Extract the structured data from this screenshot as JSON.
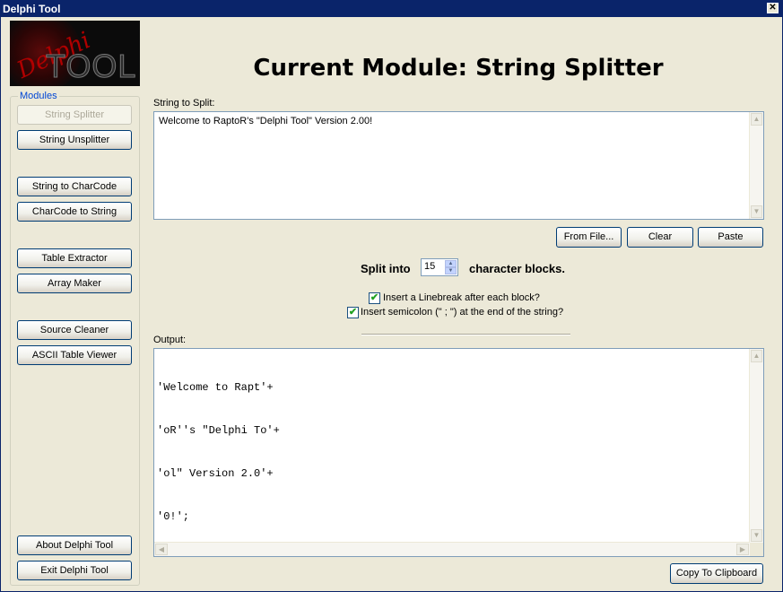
{
  "window": {
    "title": "Delphi Tool",
    "close_glyph": "✕"
  },
  "logo": {
    "script_text": "Delphi",
    "block_text": "TOOL"
  },
  "modules": {
    "legend": "Modules",
    "items": [
      {
        "label": "String Splitter",
        "enabled": false
      },
      {
        "label": "String Unsplitter",
        "enabled": true
      },
      {
        "label": "String to CharCode",
        "enabled": true
      },
      {
        "label": "CharCode to String",
        "enabled": true
      },
      {
        "label": "Table Extractor",
        "enabled": true
      },
      {
        "label": "Array Maker",
        "enabled": true
      },
      {
        "label": "Source Cleaner",
        "enabled": true
      },
      {
        "label": "ASCII Table Viewer",
        "enabled": true
      }
    ],
    "about_label": "About Delphi Tool",
    "exit_label": "Exit Delphi Tool"
  },
  "main": {
    "heading": "Current Module: String Splitter",
    "input_label": "String to Split:",
    "input_value": "Welcome to RaptoR's \"Delphi Tool\" Version 2.00!",
    "from_file_label": "From File...",
    "clear_label": "Clear",
    "paste_label": "Paste",
    "split_prefix": "Split into",
    "split_value": "15",
    "split_suffix": "character blocks.",
    "option_linebreak": {
      "label": "Insert a Linebreak after each block?",
      "checked": true
    },
    "option_semicolon": {
      "label": "Insert semicolon (\" ; \") at the end of the string?",
      "checked": true
    },
    "output_label": "Output:",
    "output_lines": [
      "'Welcome to Rapt'+",
      "'oR''s \"Delphi To'+",
      "'ol\" Version 2.0'+",
      "'0!';"
    ],
    "copy_label": "Copy To Clipboard"
  },
  "glyphs": {
    "check": "✔",
    "up": "▲",
    "down": "▼",
    "left": "◀",
    "right": "▶"
  },
  "colors": {
    "titlebar": "#0a246a",
    "face": "#ece9d8",
    "legend": "#0046d5"
  }
}
